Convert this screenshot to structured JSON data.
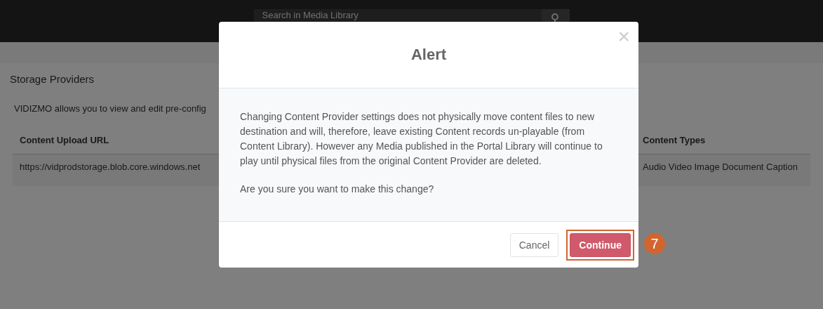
{
  "header": {
    "search": {
      "placeholder": "Search in Media Library"
    }
  },
  "page": {
    "title": "Storage Providers",
    "intro": "VIDIZMO allows you to view and edit pre-config",
    "table": {
      "columns": [
        "Content Upload URL",
        "Content Types"
      ],
      "rows": [
        [
          "https://vidprodstorage.blob.core.windows.net",
          "Audio Video Image Document Caption"
        ]
      ]
    }
  },
  "dialog": {
    "title": "Alert",
    "close": "×",
    "paragraphs": [
      "Changing Content Provider settings does not physically move content files to new destination and will, therefore, leave existing Content records un-playable (from Content Library). However any Media published in the Portal Library will continue to play until physical files from the original Content Provider are deleted.",
      "Are you sure you want to make this change?"
    ],
    "buttons": [
      {
        "label": "Cancel",
        "kind": "secondary",
        "highlighted": false
      },
      {
        "label": "Continue",
        "kind": "primary",
        "highlighted": true
      }
    ]
  },
  "annotation": {
    "step": "7"
  }
}
